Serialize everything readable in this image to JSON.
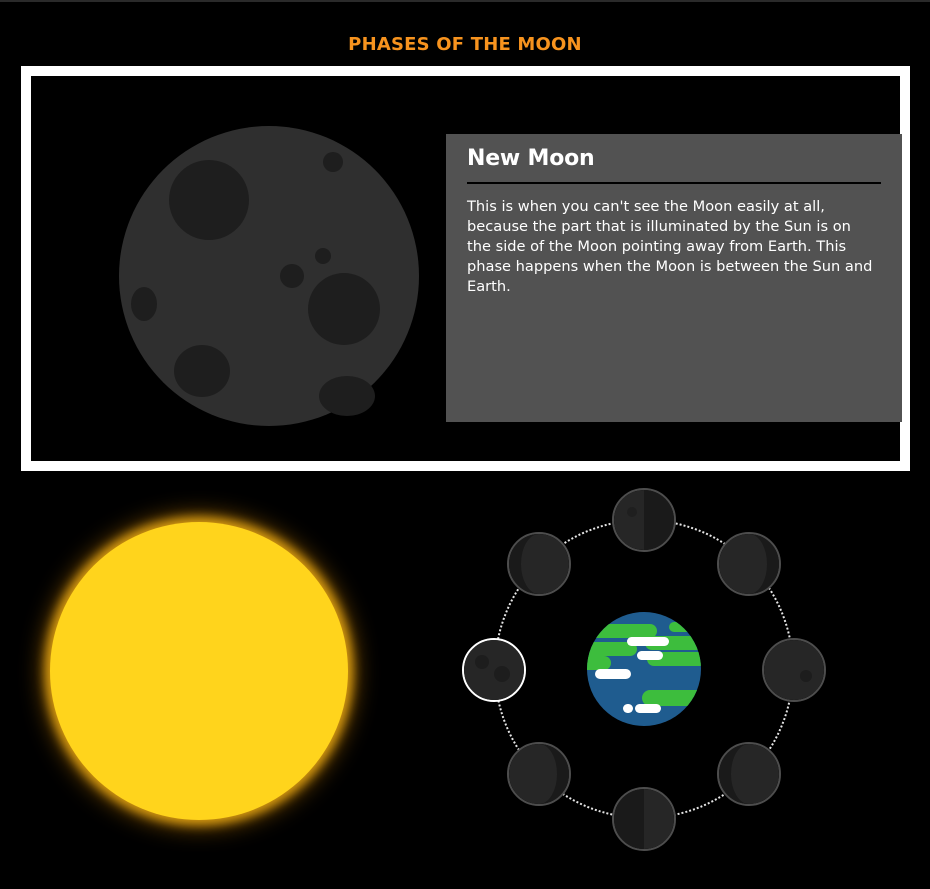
{
  "page": {
    "title": "PHASES OF THE MOON",
    "accent_color": "#f7931e"
  },
  "info": {
    "title": "New Moon",
    "description": "This is when you can't see the Moon easily at all, because the part that is illuminated by the Sun is on the side of the Moon pointing away from Earth. This phase happens when the Moon is between the Sun and Earth."
  },
  "scene": {
    "sun_icon": "sun-icon",
    "earth_icon": "earth-icon",
    "moon_icon": "moon-icon",
    "colors": {
      "sun": "#ffd41c",
      "earth_ocean": "#1f5c8f",
      "earth_land": "#3dbd3d",
      "moon": "#2f2f2f",
      "moon_crater": "#1e1e1e"
    }
  },
  "phases": [
    {
      "id": "new-moon",
      "active": true
    },
    {
      "id": "waxing-crescent",
      "active": false
    },
    {
      "id": "first-quarter",
      "active": false
    },
    {
      "id": "waxing-gibbous",
      "active": false
    },
    {
      "id": "full-moon",
      "active": false
    },
    {
      "id": "waning-gibbous",
      "active": false
    },
    {
      "id": "third-quarter",
      "active": false
    },
    {
      "id": "waning-crescent",
      "active": false
    }
  ]
}
